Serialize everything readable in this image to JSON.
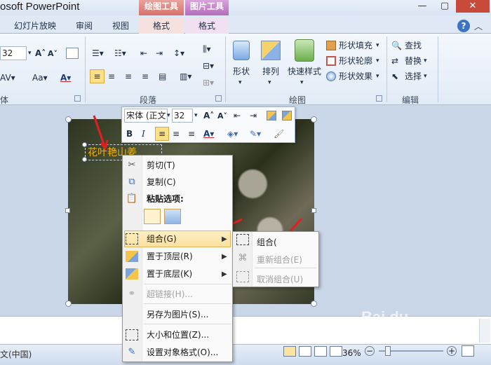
{
  "window": {
    "title": "osoft PowerPoint"
  },
  "context_tab_heads": {
    "drawing": "绘图工具",
    "picture": "图片工具"
  },
  "ribbon_tabs": [
    "幻灯片放映",
    "审阅",
    "视图",
    "格式",
    "格式"
  ],
  "font": {
    "size": "32",
    "size_mini": "32",
    "name_mini": "宋体 (正文"
  },
  "groups": {
    "paragraph": "段落",
    "drawing": "绘图",
    "editing": "编辑",
    "font_partial": "体"
  },
  "drawing_buttons": {
    "shapes": "形状",
    "arrange": "排列",
    "quick_styles": "快速样式",
    "fill": "形状填充",
    "outline": "形状轮廓",
    "effects": "形状效果"
  },
  "editing_buttons": {
    "find": "查找",
    "replace": "替换",
    "select": "选择"
  },
  "slide": {
    "textbox_text": "花叶艳山姜"
  },
  "context_menu": {
    "cut": "剪切(T)",
    "copy": "复制(C)",
    "paste_options": "粘贴选项:",
    "group": "组合(G)",
    "bring_front": "置于顶层(R)",
    "send_back": "置于底层(K)",
    "hyperlink": "超链接(H)...",
    "save_as_picture": "另存为图片(S)...",
    "size_position": "大小和位置(Z)...",
    "format_object": "设置对象格式(O)..."
  },
  "submenu": {
    "group": "组合(",
    "regroup": "重新组合(E)",
    "ungroup": "取消组合(U)"
  },
  "status": {
    "language": "文(中国)",
    "zoom": "36%"
  },
  "watermark": "Bai du"
}
